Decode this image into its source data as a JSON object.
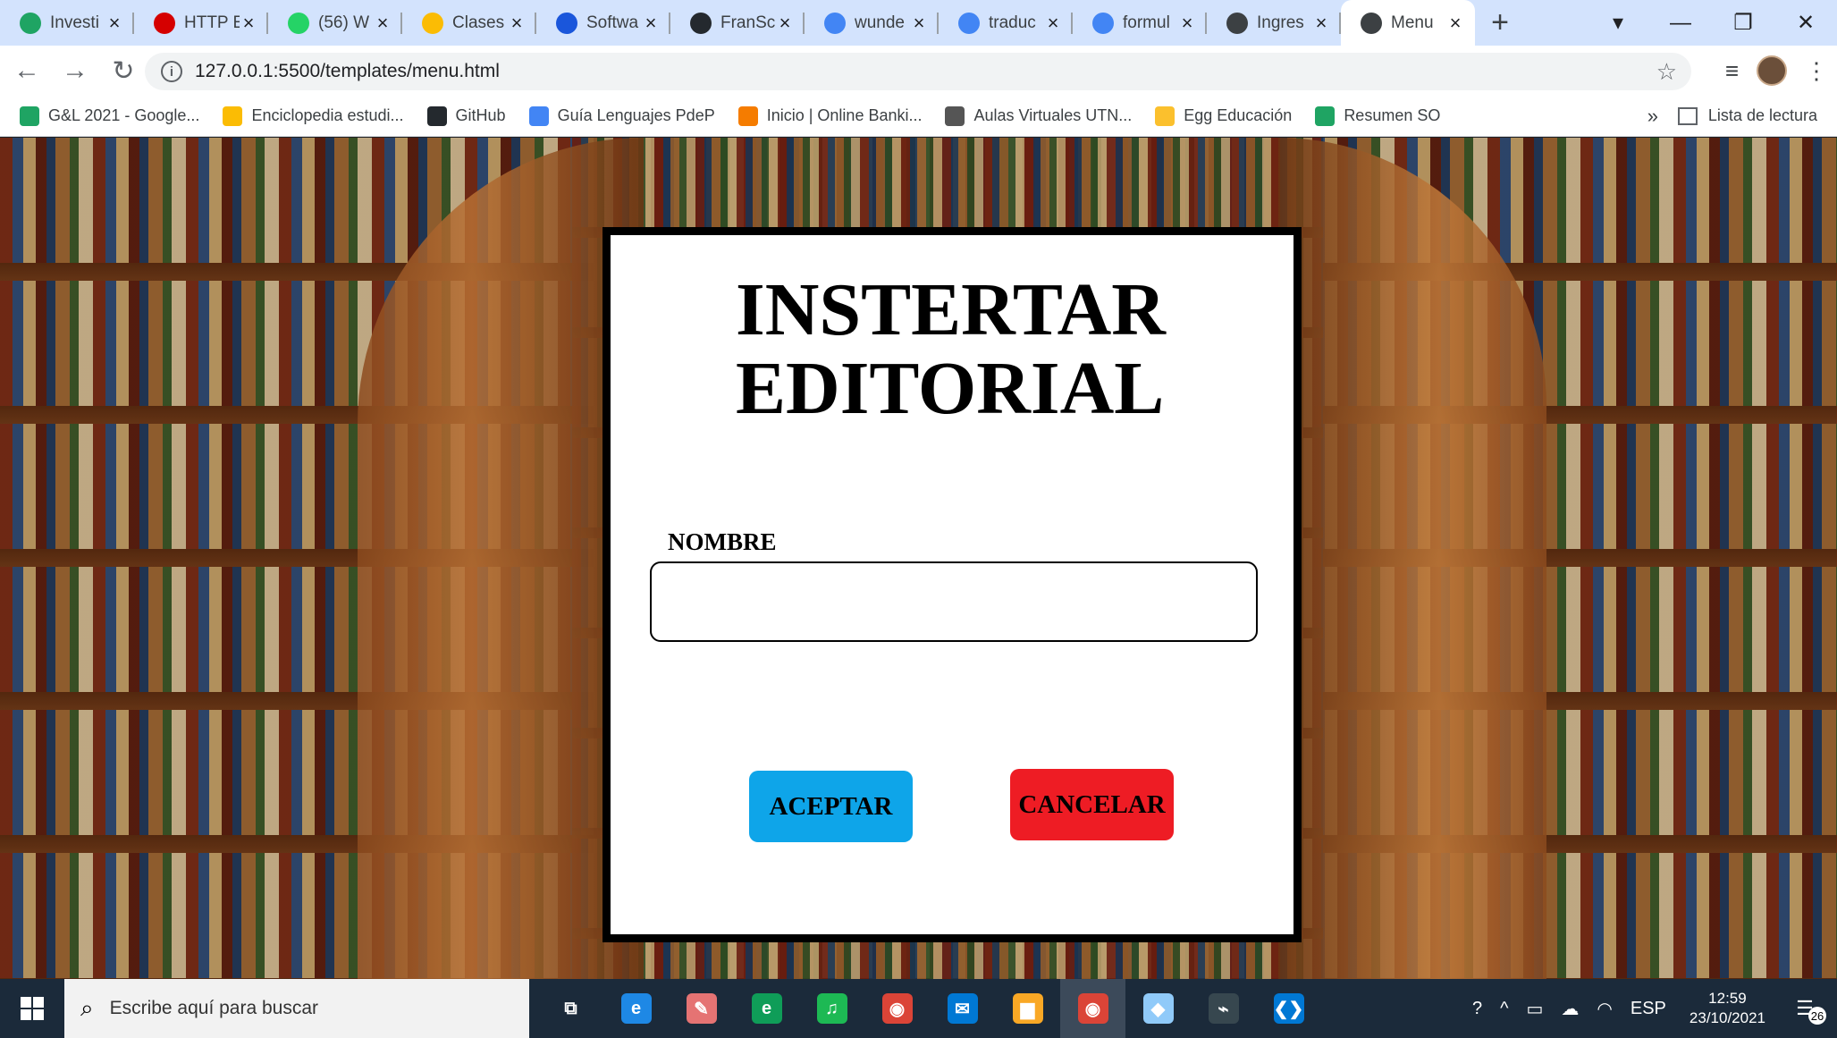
{
  "browser": {
    "tabs": [
      {
        "title": "Investi",
        "icon": "google-drive-icon",
        "color": "#1fa463"
      },
      {
        "title": "HTTP E",
        "icon": "w-logo-icon",
        "color": "#d50000"
      },
      {
        "title": "(56) W",
        "icon": "whatsapp-icon",
        "color": "#25d366"
      },
      {
        "title": "Clases",
        "icon": "google-drive-icon",
        "color": "#fbbc04"
      },
      {
        "title": "Softwa",
        "icon": "colored-square-icon",
        "color": "#1a56db"
      },
      {
        "title": "FranSc",
        "icon": "github-icon",
        "color": "#24292e"
      },
      {
        "title": "wunde",
        "icon": "google-icon",
        "color": "#4285f4"
      },
      {
        "title": "traduc",
        "icon": "google-icon",
        "color": "#4285f4"
      },
      {
        "title": "formul",
        "icon": "google-icon",
        "color": "#4285f4"
      },
      {
        "title": "Ingres",
        "icon": "globe-icon",
        "color": "#3c4043"
      },
      {
        "title": "Menu",
        "icon": "globe-icon",
        "color": "#3c4043",
        "active": true
      }
    ],
    "new_tab": "+",
    "window_controls": {
      "minimize": "—",
      "restore": "❐",
      "close": "✕",
      "tab_search": "▾"
    },
    "url": "127.0.0.1:5500/templates/menu.html",
    "bookmarks": [
      {
        "label": "G&L 2021 - Google...",
        "icon": "google-drive-icon",
        "color": "#1fa463"
      },
      {
        "label": "Enciclopedia estudi...",
        "icon": "google-drive-icon",
        "color": "#fbbc04"
      },
      {
        "label": "GitHub",
        "icon": "github-icon",
        "color": "#24292e"
      },
      {
        "label": "Guía Lenguajes PdeP",
        "icon": "docs-icon",
        "color": "#4285f4"
      },
      {
        "label": "Inicio | Online Banki...",
        "icon": "bank-icon",
        "color": "#f57c00"
      },
      {
        "label": "Aulas Virtuales UTN...",
        "icon": "utn-icon",
        "color": "#555555"
      },
      {
        "label": "Egg Educación",
        "icon": "egg-icon",
        "color": "#fbc02d"
      },
      {
        "label": "Resumen SO",
        "icon": "google-drive-icon",
        "color": "#1fa463"
      }
    ],
    "bookmarks_more": "»",
    "reading_list": "Lista de lectura"
  },
  "form": {
    "title_line1": "INSTERTAR",
    "title_line2": "EDITORIAL",
    "name_label": "NOMBRE",
    "name_value": "",
    "accept_label": "ACEPTAR",
    "cancel_label": "CANCELAR",
    "accept_color": "#0ea5e9",
    "cancel_color": "#ee1c24"
  },
  "taskbar": {
    "search_placeholder": "Escribe aquí para buscar",
    "apps": [
      {
        "name": "task-view-icon",
        "glyph": "⧉",
        "color": "transparent"
      },
      {
        "name": "internet-explorer-icon",
        "glyph": "e",
        "color": "#1e88e5"
      },
      {
        "name": "paint-icon",
        "glyph": "✎",
        "color": "#e57373"
      },
      {
        "name": "edge-icon",
        "glyph": "e",
        "color": "#0f9d58"
      },
      {
        "name": "spotify-icon",
        "glyph": "♫",
        "color": "#1db954"
      },
      {
        "name": "chrome-icon",
        "glyph": "◉",
        "color": "#db4437"
      },
      {
        "name": "mail-icon",
        "glyph": "✉",
        "color": "#0078d4"
      },
      {
        "name": "file-explorer-icon",
        "glyph": "▆",
        "color": "#f9a825"
      },
      {
        "name": "chrome-profile-icon",
        "glyph": "◉",
        "color": "#db4437",
        "active": true
      },
      {
        "name": "cube-app-icon",
        "glyph": "◆",
        "color": "#90caf9"
      },
      {
        "name": "sql-tool-icon",
        "glyph": "⌁",
        "color": "#37474f"
      },
      {
        "name": "vscode-icon",
        "glyph": "❮❯",
        "color": "#0078d4"
      }
    ],
    "tray_language": "ESP",
    "time": "12:59",
    "date": "23/10/2021",
    "notification_count": "26"
  }
}
